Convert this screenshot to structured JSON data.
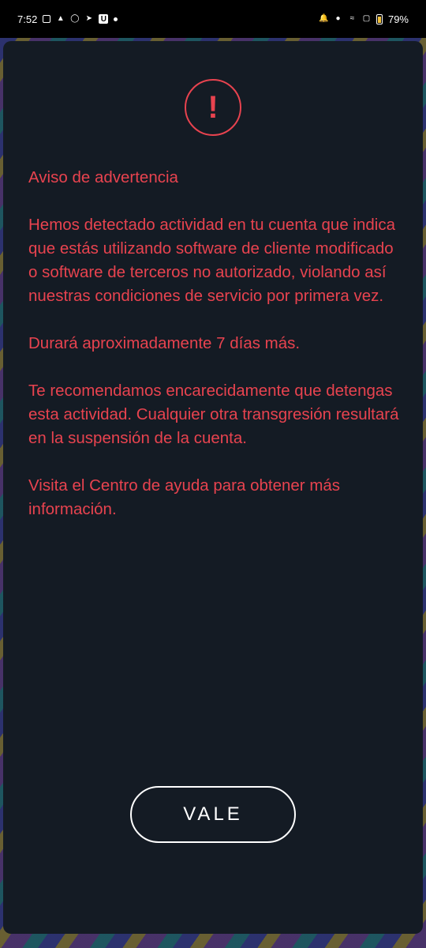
{
  "status_bar": {
    "time": "7:52",
    "battery_percent": "79%",
    "left_icons": [
      "news-icon",
      "snapchat-icon",
      "whatsapp-icon",
      "telegram-icon",
      "u-app-icon",
      "dot-icon"
    ],
    "right_icons": [
      "mute-icon",
      "location-icon",
      "wifi-icon",
      "signal-icon",
      "battery-icon"
    ]
  },
  "dialog": {
    "icon": "exclamation-circle-icon",
    "icon_glyph": "!",
    "title": "Aviso de advertencia",
    "paragraph_1": "Hemos detectado actividad en tu cuenta que indica que estás utilizando software de cliente modificado o software de terceros no autorizado, violando así nuestras condiciones de servicio por primera vez.",
    "paragraph_2": "Durará aproximadamente 7 días más.",
    "paragraph_3": "Te recomendamos encarecidamente que detengas esta actividad. Cualquier otra transgresión resultará en la suspensión de la cuenta.",
    "help_prefix": "Visita el ",
    "help_link": "Centro de ayuda",
    "help_suffix": "  para obtener más información.",
    "ok_label": "VALE"
  },
  "colors": {
    "accent": "#e8434f",
    "dialog_bg": "#141b24",
    "button_border": "#ffffff"
  }
}
